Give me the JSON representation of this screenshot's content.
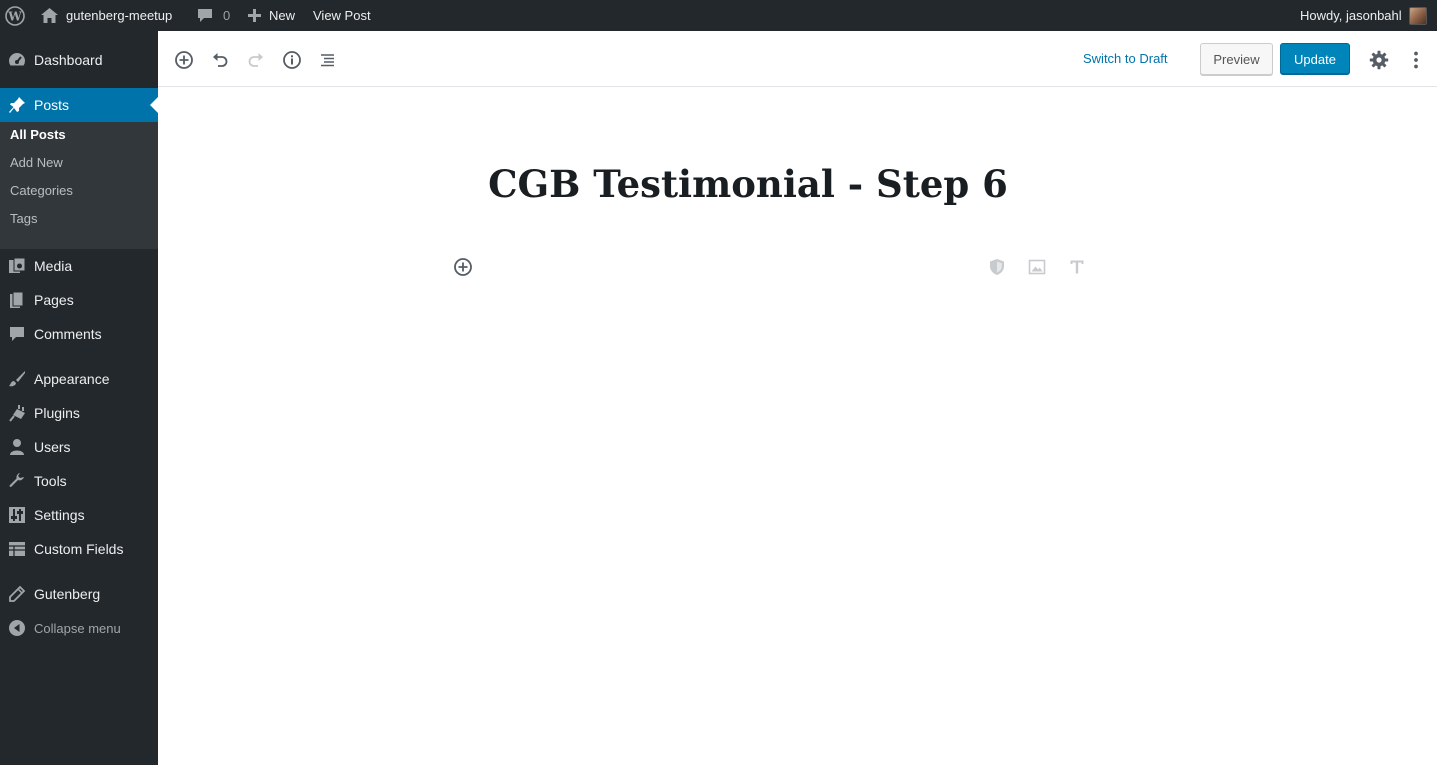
{
  "adminbar": {
    "site_name": "gutenberg-meetup",
    "comments_count": "0",
    "new_label": "New",
    "view_post_label": "View Post",
    "greeting": "Howdy, jasonbahl"
  },
  "sidebar": {
    "items": [
      {
        "label": "Dashboard",
        "icon": "dashboard-icon"
      },
      {
        "label": "Posts",
        "icon": "pushpin-icon"
      },
      {
        "label": "Media",
        "icon": "media-icon"
      },
      {
        "label": "Pages",
        "icon": "pages-icon"
      },
      {
        "label": "Comments",
        "icon": "comment-icon"
      },
      {
        "label": "Appearance",
        "icon": "paintbrush-icon"
      },
      {
        "label": "Plugins",
        "icon": "plug-icon"
      },
      {
        "label": "Users",
        "icon": "user-icon"
      },
      {
        "label": "Tools",
        "icon": "wrench-icon"
      },
      {
        "label": "Settings",
        "icon": "settings-sliders-icon"
      },
      {
        "label": "Custom Fields",
        "icon": "table-icon"
      },
      {
        "label": "Gutenberg",
        "icon": "pencil-icon"
      }
    ],
    "submenu": [
      "All Posts",
      "Add New",
      "Categories",
      "Tags"
    ],
    "collapse_label": "Collapse menu"
  },
  "editor": {
    "switch_to_draft": "Switch to Draft",
    "preview": "Preview",
    "update": "Update",
    "post_title": "CGB Testimonial - Step 6"
  },
  "colors": {
    "admin_dark": "#23282d",
    "accent_blue": "#0073aa",
    "update_button": "#0085ba"
  }
}
